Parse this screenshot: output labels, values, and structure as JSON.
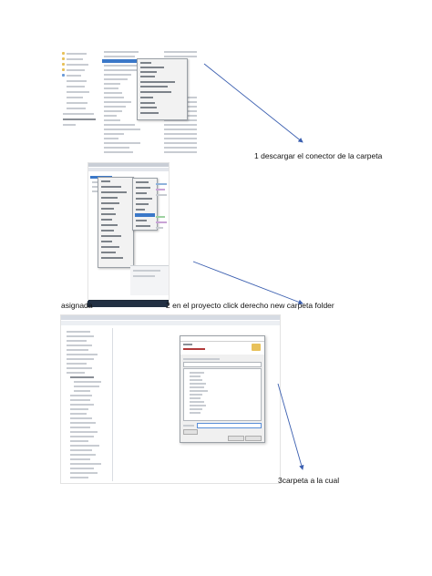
{
  "captions": {
    "step1": "1 descargar el conector de la carpeta",
    "step2_prefix": "asignada",
    "step2": "2 en el proyecto click derecho new carpeta folder",
    "step3": "3carpeta a la cual"
  },
  "colors": {
    "arrow": "#3b5fb0",
    "selection": "#3b78c8",
    "dialog_bg": "#f0f0f0",
    "folder_icon": "#e8c15a"
  },
  "icons": [
    "folder-icon",
    "file-icon",
    "arrow-icon"
  ]
}
